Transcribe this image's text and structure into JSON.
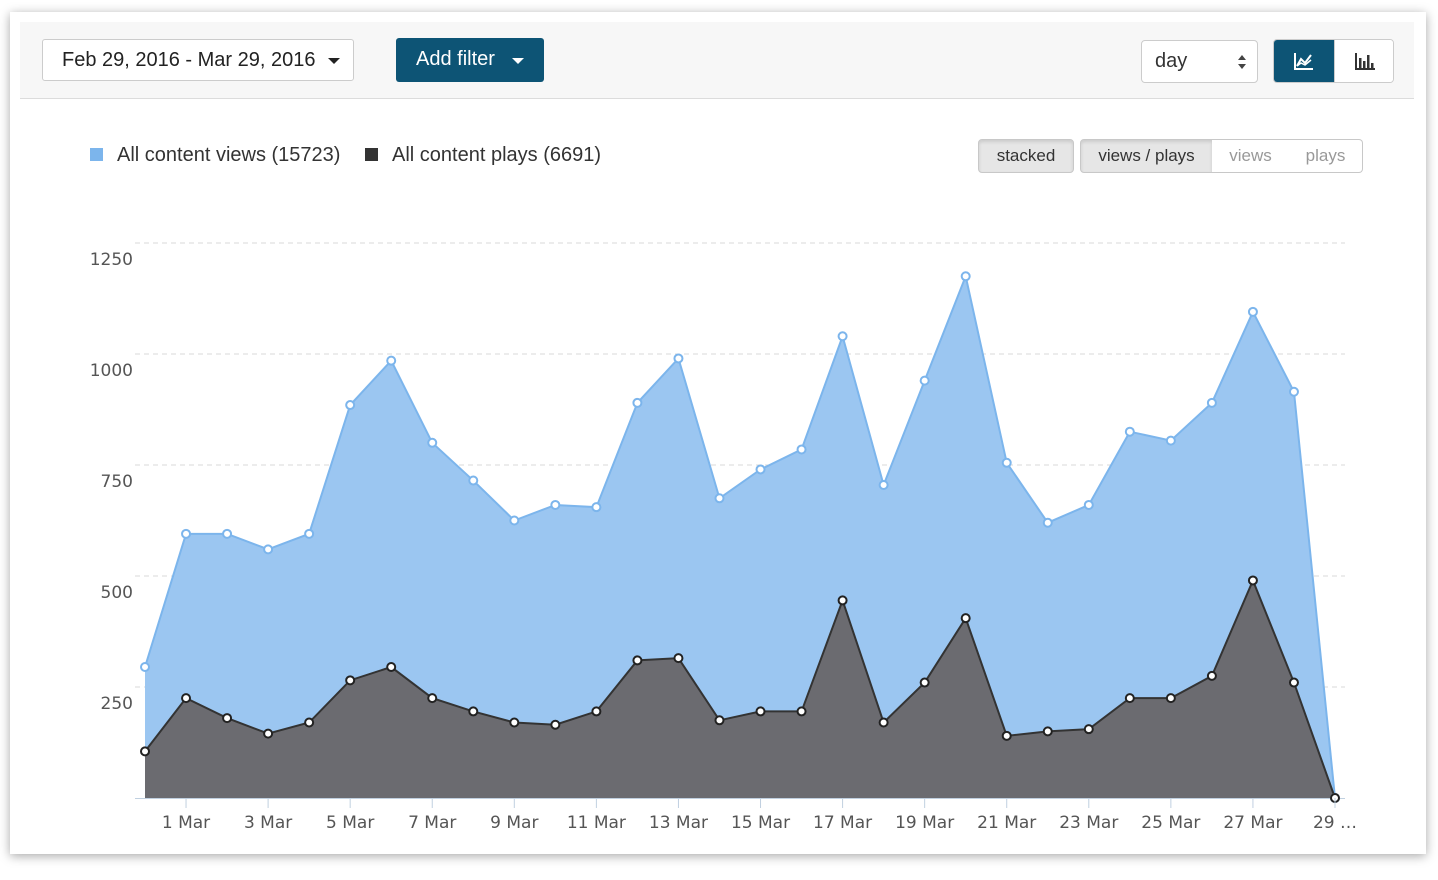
{
  "toolbar": {
    "date_range": "Feb 29, 2016 - Mar 29, 2016",
    "add_filter_label": "Add filter",
    "granularity": "day"
  },
  "legend": {
    "views": "All content views (15723)",
    "plays": "All content plays (6691)"
  },
  "mode_buttons": {
    "stacked": "stacked",
    "views_plays": "views / plays",
    "views": "views",
    "plays": "plays"
  },
  "chart_data": {
    "type": "area",
    "x": [
      "29 Feb",
      "1 Mar",
      "2 Mar",
      "3 Mar",
      "4 Mar",
      "5 Mar",
      "6 Mar",
      "7 Mar",
      "8 Mar",
      "9 Mar",
      "10 Mar",
      "11 Mar",
      "12 Mar",
      "13 Mar",
      "14 Mar",
      "15 Mar",
      "16 Mar",
      "17 Mar",
      "18 Mar",
      "19 Mar",
      "20 Mar",
      "21 Mar",
      "22 Mar",
      "23 Mar",
      "24 Mar",
      "25 Mar",
      "26 Mar",
      "27 Mar",
      "28 Mar",
      "29 Mar"
    ],
    "x_tick_labels": [
      "1 Mar",
      "3 Mar",
      "5 Mar",
      "7 Mar",
      "9 Mar",
      "11 Mar",
      "13 Mar",
      "15 Mar",
      "17 Mar",
      "19 Mar",
      "21 Mar",
      "23 Mar",
      "25 Mar",
      "27 Mar",
      "29 …"
    ],
    "series": [
      {
        "name": "All content views (15723)",
        "color": "#9bc6f1",
        "line_color": "#7cb5ec",
        "values": [
          295,
          595,
          595,
          560,
          595,
          885,
          985,
          800,
          715,
          625,
          660,
          655,
          890,
          990,
          675,
          740,
          785,
          1040,
          705,
          940,
          1175,
          755,
          620,
          660,
          825,
          805,
          890,
          1095,
          915,
          0
        ]
      },
      {
        "name": "All content plays (6691)",
        "color": "#6b6b70",
        "line_color": "#333333",
        "values": [
          105,
          225,
          180,
          145,
          170,
          265,
          295,
          225,
          195,
          170,
          165,
          195,
          310,
          315,
          175,
          195,
          195,
          445,
          170,
          260,
          405,
          140,
          150,
          155,
          225,
          225,
          275,
          490,
          260,
          0
        ]
      }
    ],
    "yticks": [
      250,
      500,
      750,
      1000,
      1250
    ],
    "ylim": [
      0,
      1250
    ],
    "grid": true
  }
}
